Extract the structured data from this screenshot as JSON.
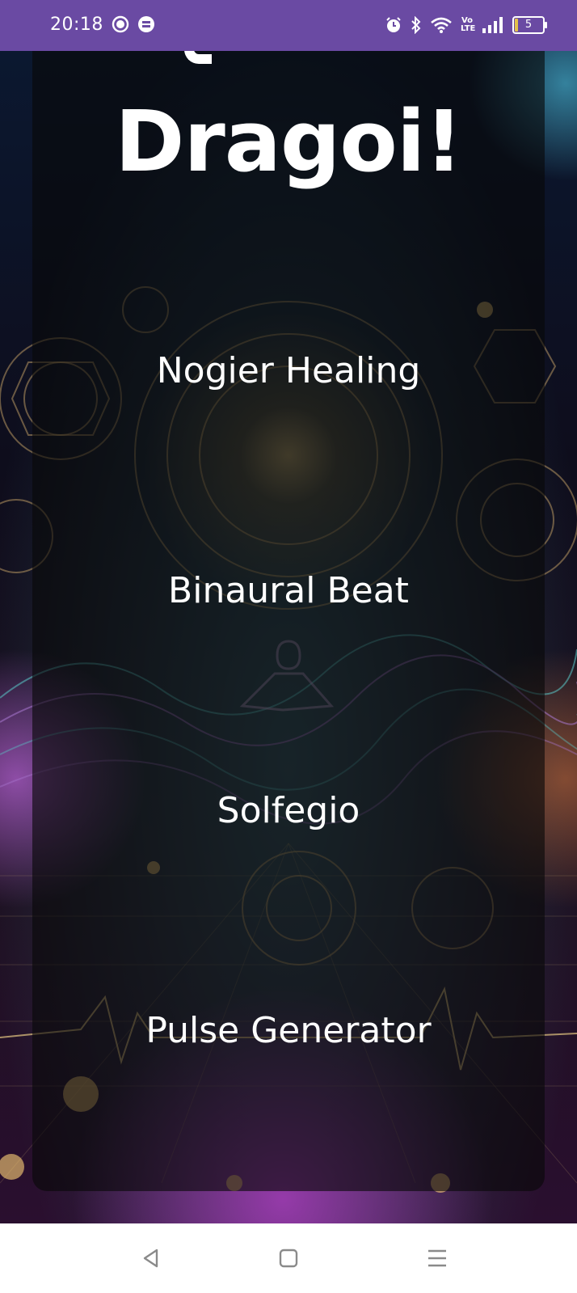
{
  "status_bar": {
    "time": "20:18",
    "battery_level": "5",
    "network_label": "Vo LTE",
    "icons": [
      "face-notification-icon",
      "app-notification-icon",
      "alarm-icon",
      "bluetooth-icon",
      "wifi-icon",
      "volte-icon",
      "signal-icon",
      "battery-icon"
    ]
  },
  "header": {
    "title": "Dragoi!"
  },
  "menu": {
    "items": [
      {
        "label": "Nogier Healing"
      },
      {
        "label": "Binaural Beat"
      },
      {
        "label": "Solfegio"
      },
      {
        "label": "Pulse Generator"
      }
    ]
  },
  "nav_bar": {
    "icons": [
      "back-icon",
      "home-icon",
      "menu-icon"
    ]
  },
  "colors": {
    "status_bar": "#6a4aa3",
    "panel_overlay": "rgba(8,8,8,0.62)",
    "text": "#ffffff",
    "nav_bar": "#ffffff",
    "nav_icon": "#8a8a8a"
  }
}
